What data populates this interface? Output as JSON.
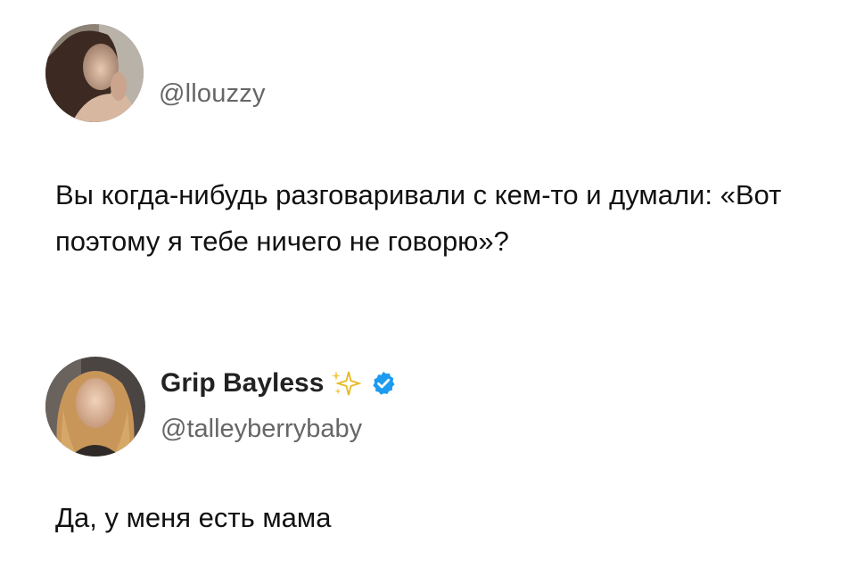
{
  "post1": {
    "avatar_icon": "avatar-photo-icon",
    "handle": "@llouzzy",
    "text": "Вы когда-нибудь разговаривали с кем-то и думали: «Вот поэтому я тебе ничего не говорю»?"
  },
  "post2": {
    "avatar_icon": "avatar-photo-icon",
    "display_name": "Grip Bayless",
    "sparkles_icon": "sparkles-icon",
    "verified_icon": "verified-badge-icon",
    "handle": "@talleyberrybaby",
    "text": "Да, у меня есть мама"
  },
  "colors": {
    "text": "#111111",
    "handle": "#666666",
    "verified": "#1d9bf0",
    "sparkle": "#f5c518"
  }
}
